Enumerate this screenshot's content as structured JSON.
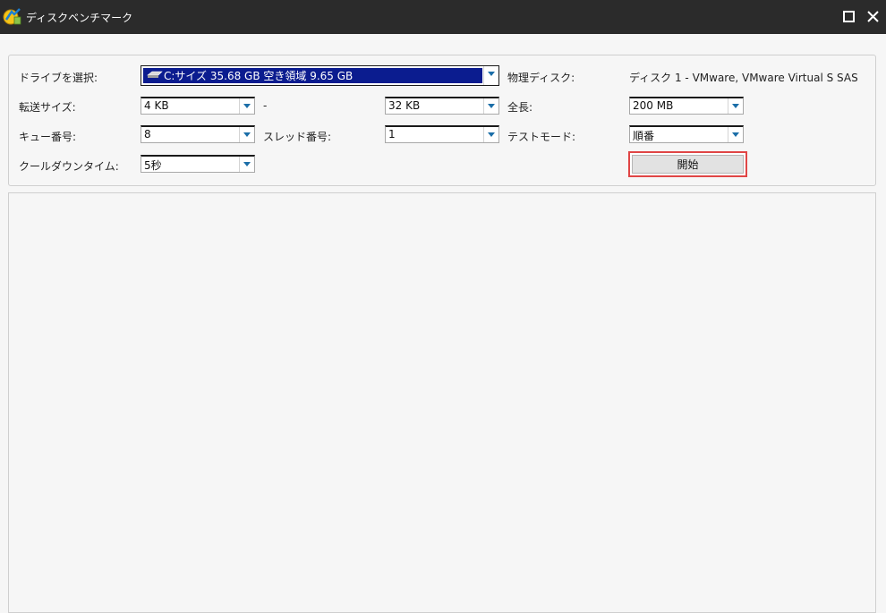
{
  "window": {
    "title": "ディスクベンチマーク"
  },
  "labels": {
    "drive": "ドライブを選択:",
    "transfer_size": "転送サイズ:",
    "range_dash": "-",
    "queue": "キュー番号:",
    "thread": "スレッド番号:",
    "cooldown": "クールダウンタイム:",
    "physical_disk": "物理ディスク:",
    "total_length": "全長:",
    "test_mode": "テストモード:"
  },
  "values": {
    "drive": "C:サイズ 35.68 GB 空き領域 9.65 GB",
    "physical_disk": "ディスク 1 - VMware, VMware Virtual S SAS",
    "transfer_min": "4 KB",
    "transfer_max": "32 KB",
    "total_length": "200 MB",
    "queue": "8",
    "thread": "1",
    "test_mode": "順番",
    "cooldown": "5秒"
  },
  "buttons": {
    "start": "開始"
  },
  "colors": {
    "titlebar_bg": "#2b2b2b",
    "selection_bg": "#0b1c8f",
    "dropdown_arrow": "#1b6ea8",
    "highlight_border": "#e04545"
  }
}
